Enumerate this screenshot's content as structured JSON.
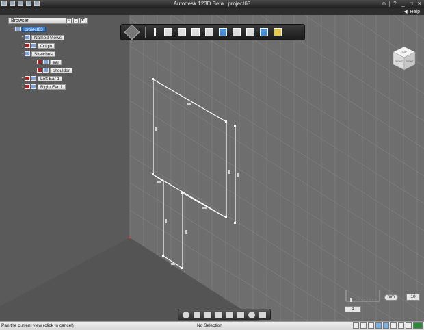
{
  "app": {
    "title": "Autodesk 123D Beta",
    "project": "project63"
  },
  "help": {
    "label": "Help",
    "arrow": "◀"
  },
  "browser": {
    "title": "Browser",
    "controls": [
      "−",
      "◻",
      "✕"
    ],
    "items": [
      {
        "label": "project63",
        "selected": true,
        "expander": "−"
      },
      {
        "label": "Named Views",
        "expander": "+"
      },
      {
        "label": "Origin",
        "expander": "+"
      },
      {
        "label": "Sketches",
        "expander": "−"
      },
      {
        "label": "ear",
        "expander": ""
      },
      {
        "label": "shoulder",
        "expander": ""
      },
      {
        "label": "Left Ear 1",
        "expander": "+"
      },
      {
        "label": "Right Ear 1",
        "expander": "+"
      }
    ]
  },
  "scale": {
    "units": "mm",
    "value": "10",
    "grid": "1"
  },
  "status": {
    "hint": "Pan the current view (click to cancel)",
    "selection": "No Selection"
  },
  "viewcube": {
    "top_face": "TOP",
    "front_face": "FRONT",
    "right_face": "RIGHT"
  },
  "colors": {
    "sketch_line": "#ffffff",
    "grid_line": "#8f8f8f",
    "viewport_plane": "#6d6d6d",
    "back_plane": "#5b5b5b"
  }
}
